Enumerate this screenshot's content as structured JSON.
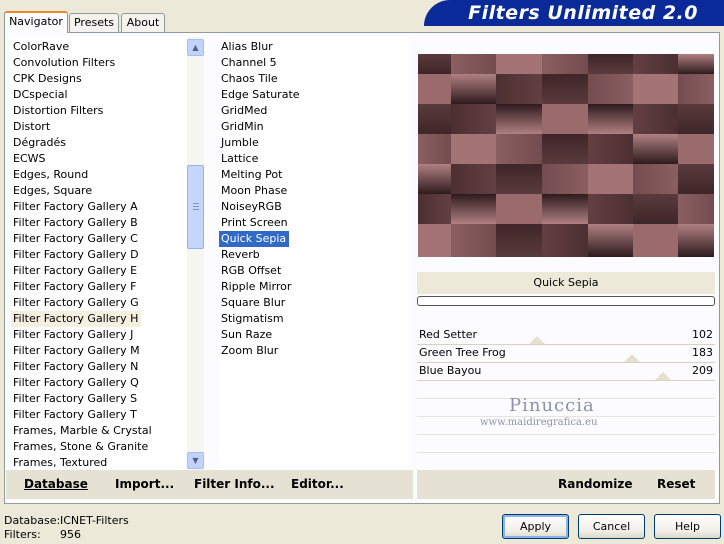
{
  "banner": {
    "title": "Filters Unlimited 2.0"
  },
  "tabs": [
    {
      "label": "Navigator",
      "active": true
    },
    {
      "label": "Presets",
      "active": false
    },
    {
      "label": "About",
      "active": false
    }
  ],
  "categories": {
    "items": [
      "ColorRave",
      "Convolution Filters",
      "CPK Designs",
      "DCspecial",
      "Distortion Filters",
      "Distort",
      "Dégradés",
      "ECWS",
      "Edges, Round",
      "Edges, Square",
      "Filter Factory Gallery A",
      "Filter Factory Gallery B",
      "Filter Factory Gallery C",
      "Filter Factory Gallery D",
      "Filter Factory Gallery E",
      "Filter Factory Gallery F",
      "Filter Factory Gallery G",
      "Filter Factory Gallery H",
      "Filter Factory Gallery J",
      "Filter Factory Gallery M",
      "Filter Factory Gallery N",
      "Filter Factory Gallery Q",
      "Filter Factory Gallery S",
      "Filter Factory Gallery T",
      "Frames, Marble & Crystal",
      "Frames, Stone & Granite",
      "Frames, Textured"
    ],
    "selected": "Filter Factory Gallery H"
  },
  "filters": {
    "items": [
      "Alias Blur",
      "Channel 5",
      "Chaos Tile",
      "Edge Saturate",
      "GridMed",
      "GridMin",
      "Jumble",
      "Lattice",
      "Melting Pot",
      "Moon Phase",
      "NoiseyRGB",
      "Print Screen",
      "Quick Sepia",
      "Reverb",
      "RGB Offset",
      "Ripple Mirror",
      "Square Blur",
      "Stigmatism",
      "Sun Raze",
      "Zoom Blur"
    ],
    "selected": "Quick Sepia"
  },
  "current_filter": "Quick Sepia",
  "progress": 0,
  "sliders": [
    {
      "label": "Red Setter",
      "value": "102"
    },
    {
      "label": "Green Tree Frog",
      "value": "183"
    },
    {
      "label": "Blue Bayou",
      "value": "209"
    }
  ],
  "watermark": {
    "name": "Pinuccia",
    "url": "www.maidiregrafica.eu"
  },
  "left_buttons": {
    "database": "Database",
    "import": "Import...",
    "filter_info": "Filter Info...",
    "editor": "Editor..."
  },
  "right_buttons": {
    "randomize": "Randomize",
    "reset": "Reset"
  },
  "footer": {
    "database_label": "Database:",
    "database_value": "ICNET-Filters",
    "filters_label": "Filters:",
    "filters_value": "956",
    "apply": "Apply",
    "cancel": "Cancel",
    "help": "Help"
  },
  "colors": {
    "banner": "#0a2a9a",
    "selection": "#316ac5",
    "tab_accent": "#e68b2c",
    "preview_base": "#6e4a4e"
  }
}
